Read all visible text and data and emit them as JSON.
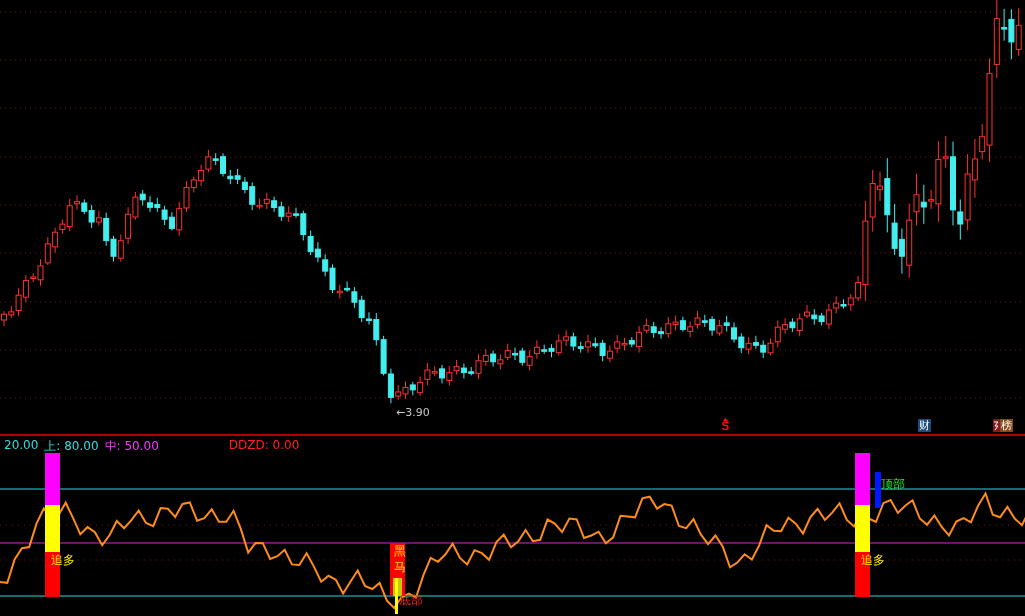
{
  "price_panel": {
    "low_label": "←3.90",
    "markers": [
      {
        "kind": "dollar"
      },
      {
        "kind": "badge",
        "label": "财",
        "color": "#1c4a78"
      },
      {
        "kind": "badge",
        "label": "榜",
        "color": "#8a4a18"
      }
    ]
  },
  "indicator_panel": {
    "legend": [
      {
        "text": "20.00",
        "color": "#33dddd"
      },
      {
        "text": "上: 80.00",
        "color": "#33dddd"
      },
      {
        "text": "中: 50.00",
        "color": "#ff33ff"
      },
      {
        "text": "DDZD: 0.00",
        "color": "#ff2020"
      }
    ],
    "signals": [
      {
        "kind": "buy",
        "label": "追多"
      },
      {
        "kind": "dark_horse",
        "label": "黑马",
        "sub_label": "底部"
      },
      {
        "kind": "buy",
        "label": "追多"
      },
      {
        "kind": "top",
        "label": "顶部"
      }
    ]
  }
}
